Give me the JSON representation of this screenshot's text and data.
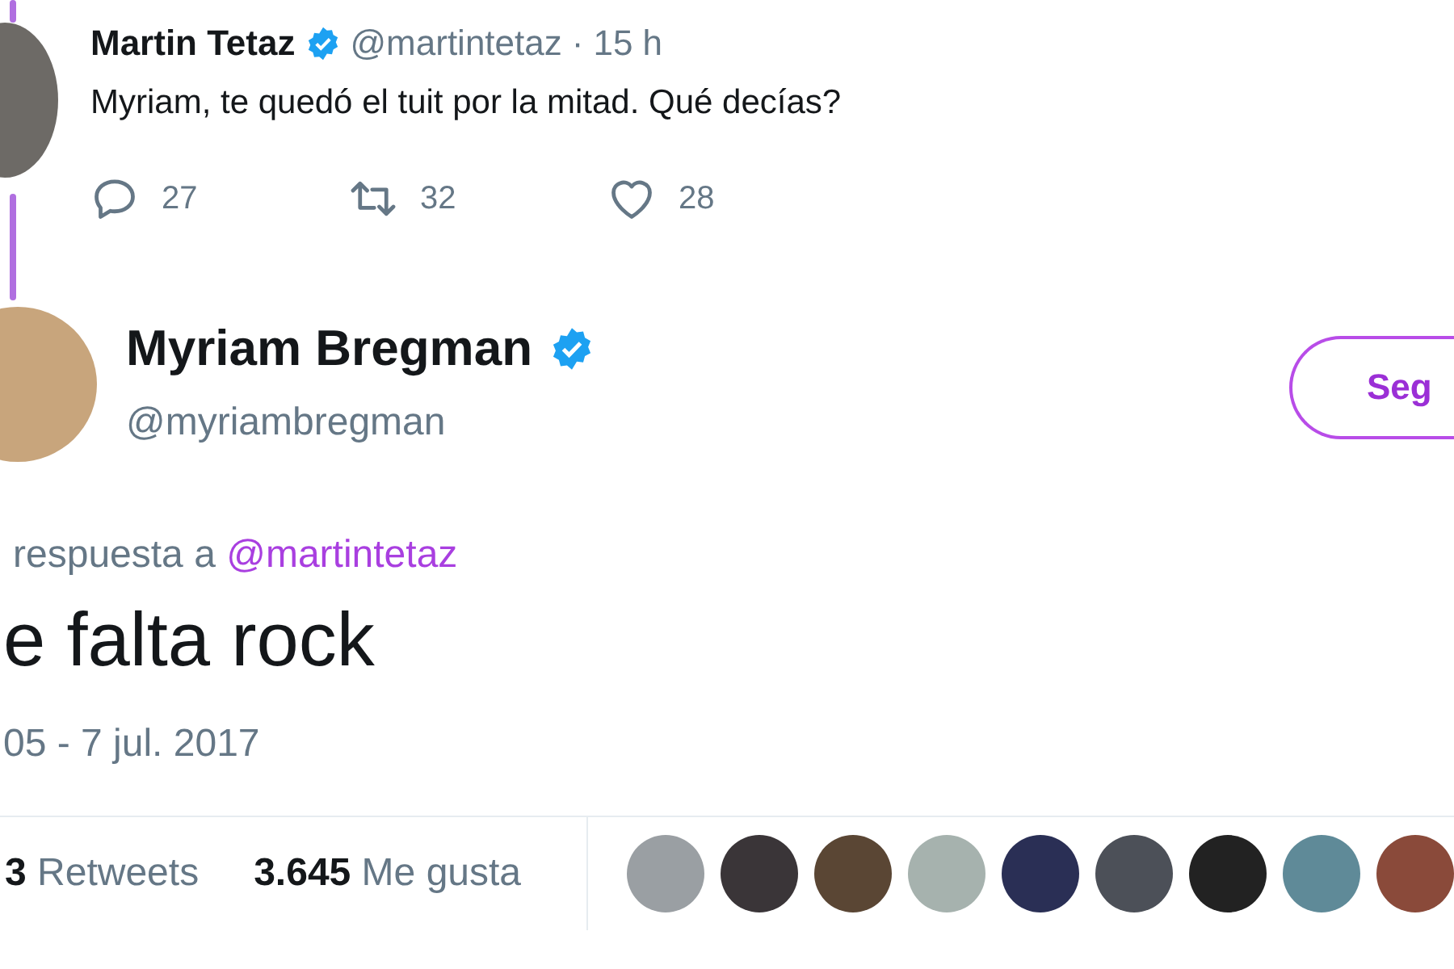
{
  "parent_tweet": {
    "name": "Martin Tetaz",
    "verified": true,
    "handle": "@martintetaz",
    "separator": "·",
    "time": "15 h",
    "text": "Myriam, te quedó el tuit por la mitad. Qué decías?",
    "actions": [
      {
        "kind": "reply",
        "count": "27"
      },
      {
        "kind": "retweet",
        "count": "32"
      },
      {
        "kind": "like",
        "count": "28"
      }
    ]
  },
  "main_tweet": {
    "name": "Myriam Bregman",
    "verified": true,
    "handle": "@myriambregman",
    "follow_button": "Seg",
    "reply_to_label": "respuesta a",
    "reply_to_handle": "@martintetaz",
    "text": "e falta rock",
    "timestamp": "05 - 7 jul. 2017",
    "stats": [
      "**3** Retweets",
      "**3.645** Me gusta"
    ],
    "liker_avatars": [
      {
        "color": "#9a9fa3"
      },
      {
        "color": "#3a3538"
      },
      {
        "color": "#5a4634"
      },
      {
        "color": "#a6b2ae"
      },
      {
        "color": "#2a2f55"
      },
      {
        "color": "#4c5058"
      },
      {
        "color": "#222222"
      },
      {
        "color": "#5f8a98"
      },
      {
        "color": "#8a4a3a"
      }
    ]
  }
}
